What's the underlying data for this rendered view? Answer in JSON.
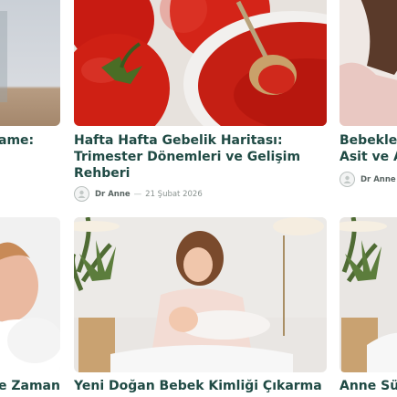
{
  "cards": [
    {
      "title_lines": [
        "ame:"
      ],
      "image_icon": "partial-left-image"
    },
    {
      "title_lines": [
        "Hafta Hafta Gebelik Haritası:",
        "Trimester Dönemleri ve Gelişim",
        "Rehberi"
      ],
      "author": "Dr Anne",
      "separator": "—",
      "date": "21 Şubat 2026",
      "image_icon": "tomato-paste-image"
    },
    {
      "title_lines": [
        "Bebekler",
        "Asit ve A"
      ],
      "author": "Dr Anne",
      "image_icon": "woman-image"
    }
  ],
  "row2": [
    {
      "title": "e Zaman",
      "image_icon": "baby-image"
    },
    {
      "title": "Yeni Doğan Bebek Kimliği Çıkarma",
      "image_icon": "mother-breastfeeding-image"
    },
    {
      "title": "Anne Süt",
      "image_icon": "mother-baby-image"
    }
  ],
  "colors": {
    "title": "#1f4a44",
    "meta": "#8a9390"
  }
}
